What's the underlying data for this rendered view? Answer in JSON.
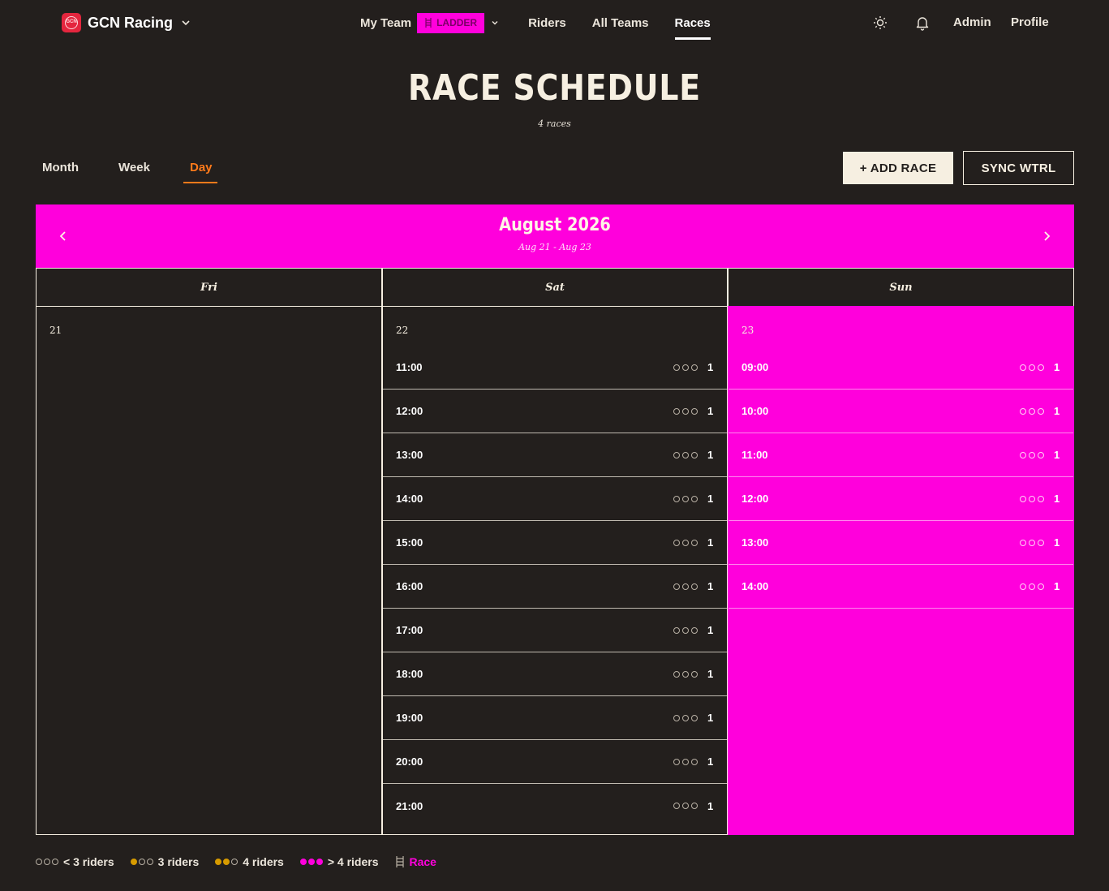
{
  "brand": {
    "name": "GCN Racing",
    "logo_text": "GCN"
  },
  "nav": {
    "my_team": "My Team",
    "ladder_badge": "LADDER",
    "riders": "Riders",
    "all_teams": "All Teams",
    "races": "Races",
    "admin": "Admin",
    "profile": "Profile"
  },
  "page": {
    "title": "RACE SCHEDULE",
    "subtitle": "4 races"
  },
  "view_tabs": {
    "month": "Month",
    "week": "Week",
    "day": "Day",
    "active": "Day"
  },
  "actions": {
    "add_race": "+ ADD RACE",
    "sync": "SYNC WTRL"
  },
  "calendar": {
    "month_title": "August 2026",
    "range": "Aug 21 - Aug 23",
    "days": [
      {
        "name": "Fri",
        "num": "21",
        "highlight": false,
        "slots": []
      },
      {
        "name": "Sat",
        "num": "22",
        "highlight": false,
        "slots": [
          {
            "time": "11:00",
            "count": "1"
          },
          {
            "time": "12:00",
            "count": "1"
          },
          {
            "time": "13:00",
            "count": "1"
          },
          {
            "time": "14:00",
            "count": "1"
          },
          {
            "time": "15:00",
            "count": "1"
          },
          {
            "time": "16:00",
            "count": "1"
          },
          {
            "time": "17:00",
            "count": "1"
          },
          {
            "time": "18:00",
            "count": "1"
          },
          {
            "time": "19:00",
            "count": "1"
          },
          {
            "time": "20:00",
            "count": "1"
          },
          {
            "time": "21:00",
            "count": "1"
          }
        ]
      },
      {
        "name": "Sun",
        "num": "23",
        "highlight": true,
        "slots": [
          {
            "time": "09:00",
            "count": "1"
          },
          {
            "time": "10:00",
            "count": "1"
          },
          {
            "time": "11:00",
            "count": "1"
          },
          {
            "time": "12:00",
            "count": "1"
          },
          {
            "time": "13:00",
            "count": "1"
          },
          {
            "time": "14:00",
            "count": "1"
          }
        ]
      }
    ]
  },
  "legend": {
    "lt3": "< 3 riders",
    "eq3": "3 riders",
    "eq4": "4 riders",
    "gt4": "> 4 riders",
    "race": "Race"
  },
  "colors": {
    "accent": "#ff00dc",
    "active_tab": "#ff7a1a",
    "background": "#231f1d",
    "cream": "#f6efe1"
  }
}
